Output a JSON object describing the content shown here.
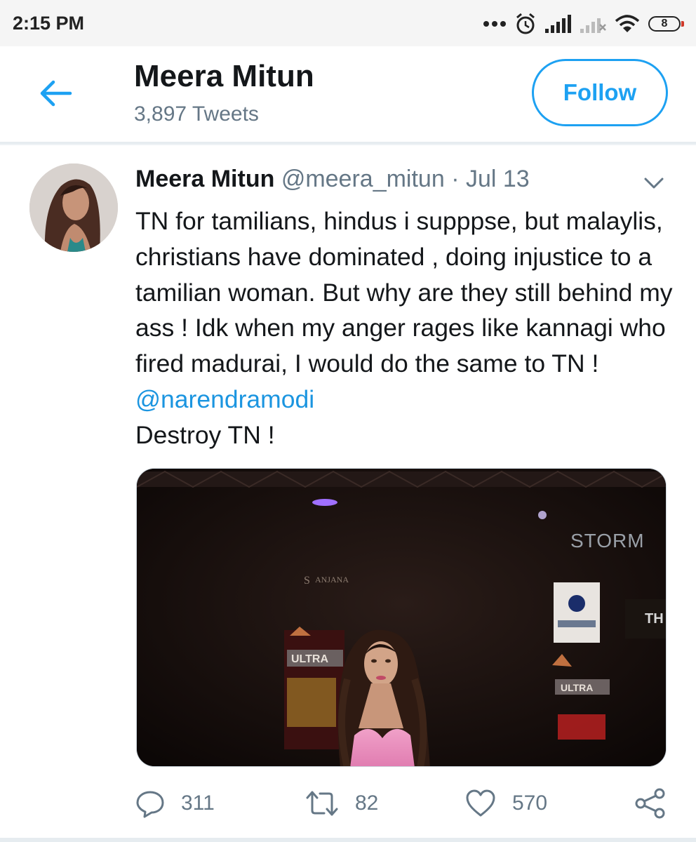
{
  "status_bar": {
    "time": "2:15 PM",
    "battery": "8",
    "icons": [
      "more-dots-icon",
      "alarm-icon",
      "signal-icon",
      "signal-off-icon",
      "wifi-icon",
      "battery-icon"
    ]
  },
  "header": {
    "name": "Meera Mitun",
    "tweet_count": "3,897 Tweets",
    "follow_label": "Follow"
  },
  "tweet": {
    "author": "Meera Mitun",
    "handle": "@meera_mitun",
    "separator": "·",
    "date": "Jul 13",
    "text_before_mention": "TN for tamilians, hindus i supppse, but malaylis, christians have dominated , doing injustice to a tamilian woman. But why are they still behind my ass !  Idk when my anger rages like kannagi who fired madurai, I would do the same to TN ! ",
    "mention": "@narendramodi",
    "text_after_mention": "Destroy TN !",
    "media": {
      "signage": [
        "STORM",
        "ULTRA",
        "ULTRA"
      ]
    }
  },
  "actions": {
    "replies": "311",
    "retweets": "82",
    "likes": "570"
  },
  "colors": {
    "accent": "#1da1f2",
    "link": "#1b95e0",
    "muted": "#657786",
    "text": "#14171a"
  }
}
